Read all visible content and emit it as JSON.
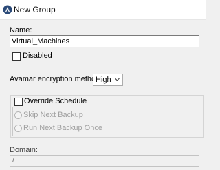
{
  "window": {
    "title": "New Group",
    "icon": "avamar-logo-icon"
  },
  "form": {
    "name_label": "Name:",
    "name_value": "Virtual_Machines",
    "disabled_label": "Disabled",
    "disabled_checked": false,
    "encryption_label": "Avamar encryption method",
    "encryption_value": "High",
    "override_label": "Override Schedule",
    "override_checked": false,
    "skip_label": "Skip Next Backup",
    "run_once_label": "Run Next Backup Once",
    "domain_label": "Domain:",
    "domain_value": "/"
  },
  "colors": {
    "background": "#f0f0f0",
    "titlebar": "#ffffff",
    "disabled_text": "#a0a0a0",
    "input_border": "#7a7a7a"
  }
}
